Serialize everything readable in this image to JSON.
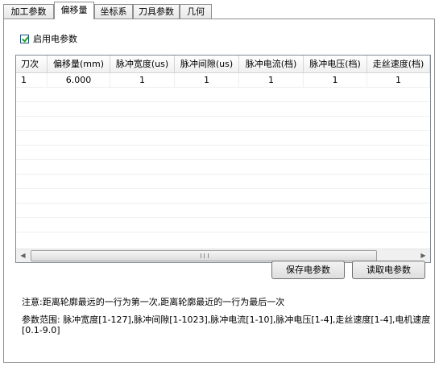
{
  "tabs": [
    {
      "label": "加工参数"
    },
    {
      "label": "偏移量"
    },
    {
      "label": "坐标系"
    },
    {
      "label": "刀具参数"
    },
    {
      "label": "几何"
    }
  ],
  "enable_checkbox": {
    "label": "启用电参数",
    "checked": true
  },
  "table": {
    "columns": [
      "刀次",
      "偏移量(mm)",
      "脉冲宽度(us)",
      "脉冲间隙(us)",
      "脉冲电流(档)",
      "脉冲电压(档)",
      "走丝速度(档)"
    ],
    "rows": [
      [
        "1",
        "6.000",
        "1",
        "1",
        "1",
        "1",
        "1"
      ]
    ]
  },
  "buttons": {
    "save": "保存电参数",
    "read": "读取电参数"
  },
  "note": "注意:距离轮廓最远的一行为第一次,距离轮廓最近的一行为最后一次",
  "range": "参数范围: 脉冲宽度[1-127],脉冲间隙[1-1023],脉冲电流[1-10],脉冲电压[1-4],走丝速度[1-4],电机速度[0.1-9.0]"
}
